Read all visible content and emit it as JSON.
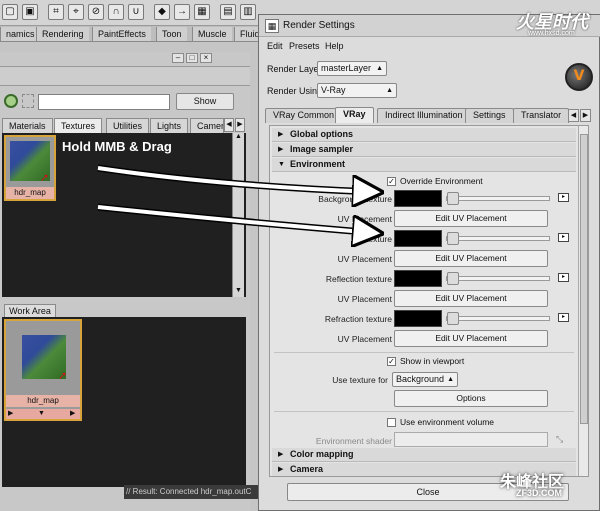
{
  "maya": {
    "shelf_tabs": [
      "namics",
      "Rendering",
      "PaintEffects",
      "Toon",
      "Muscle",
      "Fluid"
    ],
    "hypershade": {
      "show_button": "Show",
      "tabs": [
        "Materials",
        "Textures",
        "Utilities",
        "Lights",
        "Camera"
      ],
      "active_tab": "Textures",
      "top_swatch_label": "hdr_map",
      "work_area_label": "Work Area",
      "work_swatch_label": "hdr_map",
      "status_text": "// Result: Connected hdr_map.outC"
    }
  },
  "annotation": {
    "hint": "Hold MMB & Drag"
  },
  "render_settings": {
    "title": "Render Settings",
    "menu": [
      "Edit",
      "Presets",
      "Help"
    ],
    "render_layer_label": "Render Layer",
    "render_layer_value": "masterLayer",
    "render_using_label": "Render Using",
    "render_using_value": "V-Ray",
    "tabs": [
      "VRay Common",
      "VRay",
      "Indirect Illumination",
      "Settings",
      "Translator"
    ],
    "active_tab": "VRay",
    "sections": {
      "global_options": "Global options",
      "image_sampler": "Image sampler",
      "environment": "Environment",
      "color_mapping": "Color mapping",
      "camera": "Camera"
    },
    "environment": {
      "override_label": "Override Environment",
      "override_checked": true,
      "bg_texture": "Background texture",
      "gi_texture": "GI texture",
      "reflection_texture": "Reflection texture",
      "refraction_texture": "Refraction texture",
      "uv_placement": "UV Placement",
      "edit_uv_placement": "Edit UV Placement",
      "show_in_viewport": "Show in viewport",
      "show_in_viewport_checked": true,
      "use_texture_for_label": "Use texture for",
      "use_texture_for_value": "Background",
      "options_button": "Options",
      "use_env_volume": "Use environment volume",
      "use_env_volume_checked": false,
      "environment_shader": "Environment shader"
    },
    "close_button": "Close"
  },
  "watermarks": {
    "top": "火星时代",
    "top_url": "www.hxsd.com",
    "bottom": "朱峰社区",
    "bottom_url": "ZF3D.COM"
  }
}
